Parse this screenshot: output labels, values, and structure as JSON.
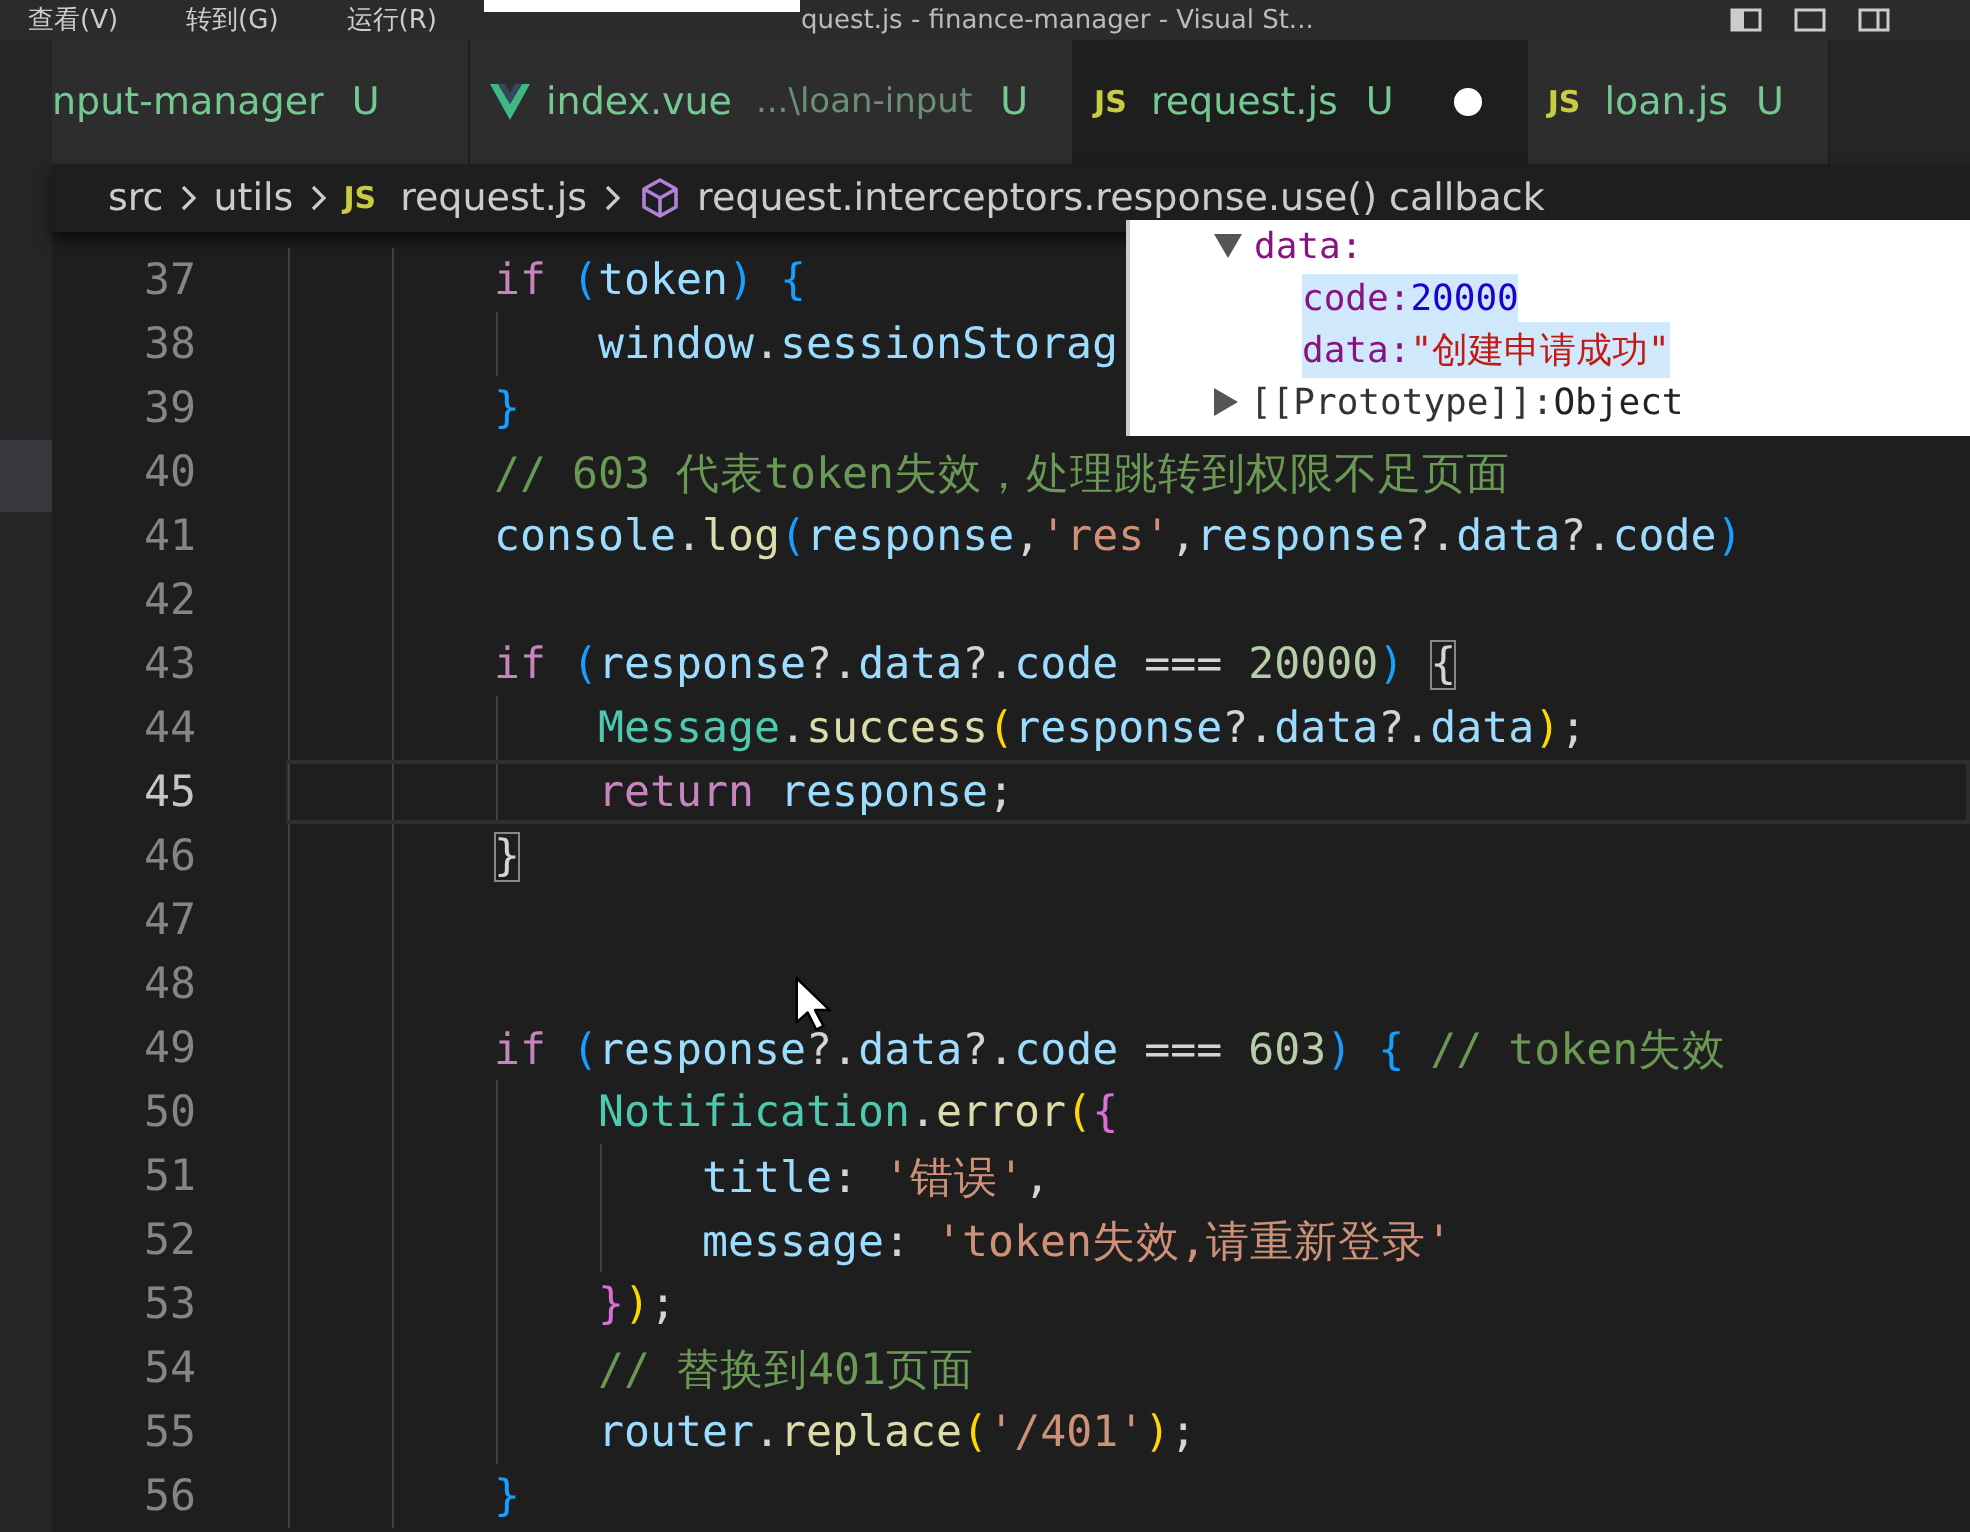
{
  "title_bar": {
    "menu": [
      "查看(V)",
      "转到(G)",
      "运行(R)"
    ],
    "title": "quest.js - finance-manager - Visual St..."
  },
  "tabs": [
    {
      "kind": "plain",
      "label": "nput-manager",
      "status": "U",
      "selected": false,
      "dirty": false
    },
    {
      "kind": "vue",
      "label": "index.vue",
      "description": "...\\loan-input",
      "status": "U",
      "selected": false,
      "dirty": false
    },
    {
      "kind": "script",
      "icon_label": "JS",
      "label": "request.js",
      "status": "U",
      "selected": true,
      "dirty": true
    },
    {
      "kind": "script",
      "icon_label": "JS",
      "label": "loan.js",
      "status": "U",
      "selected": false,
      "dirty": false
    }
  ],
  "breadcrumb": [
    {
      "kind": "folder",
      "text": "src"
    },
    {
      "kind": "folder",
      "text": "utils"
    },
    {
      "kind": "script",
      "icon_label": "JS",
      "text": "request.js"
    },
    {
      "kind": "symbol",
      "text": "request.interceptors.response.use() callback"
    }
  ],
  "lines": [
    {
      "number": "37",
      "current": false,
      "tokens": [
        {
          "kind": "kw",
          "text": "        if"
        },
        {
          "kind": "bracket3",
          "text": " ("
        },
        {
          "kind": "var",
          "text": "token"
        },
        {
          "kind": "bracket3",
          "text": ") {"
        }
      ]
    },
    {
      "number": "38",
      "current": false,
      "tokens": [
        {
          "kind": "var",
          "text": "            window"
        },
        {
          "kind": "plain",
          "text": "."
        },
        {
          "kind": "var",
          "text": "sessionStorag"
        }
      ]
    },
    {
      "number": "39",
      "current": false,
      "tokens": [
        {
          "kind": "bracket3",
          "text": "        }"
        }
      ]
    },
    {
      "number": "40",
      "current": false,
      "tokens": [
        {
          "kind": "cmt",
          "text": "        // 603 代表token失效，处理跳转到权限不足页面"
        }
      ]
    },
    {
      "number": "41",
      "current": false,
      "tokens": [
        {
          "kind": "var",
          "text": "        console"
        },
        {
          "kind": "plain",
          "text": "."
        },
        {
          "kind": "fn",
          "text": "log"
        },
        {
          "kind": "bracket3",
          "text": "("
        },
        {
          "kind": "var",
          "text": "response"
        },
        {
          "kind": "plain",
          "text": ","
        },
        {
          "kind": "str",
          "text": "'res'"
        },
        {
          "kind": "plain",
          "text": ","
        },
        {
          "kind": "var",
          "text": "response"
        },
        {
          "kind": "plain",
          "text": "?."
        },
        {
          "kind": "var",
          "text": "data"
        },
        {
          "kind": "plain",
          "text": "?."
        },
        {
          "kind": "var",
          "text": "code"
        },
        {
          "kind": "bracket3",
          "text": ")"
        }
      ]
    },
    {
      "number": "42",
      "current": false
    },
    {
      "number": "43",
      "current": false,
      "tokens": [
        {
          "kind": "kw",
          "text": "        if"
        },
        {
          "kind": "bracket3",
          "text": " ("
        },
        {
          "kind": "var",
          "text": "response"
        },
        {
          "kind": "plain",
          "text": "?."
        },
        {
          "kind": "var",
          "text": "data"
        },
        {
          "kind": "plain",
          "text": "?."
        },
        {
          "kind": "var",
          "text": "code"
        },
        {
          "kind": "plain",
          "text": " === "
        },
        {
          "kind": "num",
          "text": "20000"
        },
        {
          "kind": "bracket3",
          "text": ") "
        },
        {
          "kind": "match",
          "text": "{"
        }
      ]
    },
    {
      "number": "44",
      "current": false,
      "tokens": [
        {
          "kind": "type",
          "text": "            Message"
        },
        {
          "kind": "plain",
          "text": "."
        },
        {
          "kind": "fn",
          "text": "success"
        },
        {
          "kind": "bracket1",
          "text": "("
        },
        {
          "kind": "var",
          "text": "response"
        },
        {
          "kind": "plain",
          "text": "?."
        },
        {
          "kind": "var",
          "text": "data"
        },
        {
          "kind": "plain",
          "text": "?."
        },
        {
          "kind": "var",
          "text": "data"
        },
        {
          "kind": "bracket1",
          "text": ")"
        },
        {
          "kind": "plain",
          "text": ";"
        }
      ]
    },
    {
      "number": "45",
      "current": true,
      "tokens": [
        {
          "kind": "kw",
          "text": "            return"
        },
        {
          "kind": "var",
          "text": " response"
        },
        {
          "kind": "plain",
          "text": ";"
        }
      ]
    },
    {
      "number": "46",
      "current": false,
      "tokens": [
        {
          "kind": "match",
          "text": "        }"
        }
      ]
    },
    {
      "number": "47",
      "current": false
    },
    {
      "number": "48",
      "current": false
    },
    {
      "number": "49",
      "current": false,
      "tokens": [
        {
          "kind": "kw",
          "text": "        if"
        },
        {
          "kind": "bracket3",
          "text": " ("
        },
        {
          "kind": "var",
          "text": "response"
        },
        {
          "kind": "plain",
          "text": "?."
        },
        {
          "kind": "var",
          "text": "data"
        },
        {
          "kind": "plain",
          "text": "?."
        },
        {
          "kind": "var",
          "text": "code"
        },
        {
          "kind": "plain",
          "text": " === "
        },
        {
          "kind": "num",
          "text": "603"
        },
        {
          "kind": "bracket3",
          "text": ") {"
        },
        {
          "kind": "cmt",
          "text": " // token失效"
        }
      ]
    },
    {
      "number": "50",
      "current": false,
      "tokens": [
        {
          "kind": "type",
          "text": "            Notification"
        },
        {
          "kind": "plain",
          "text": "."
        },
        {
          "kind": "fn",
          "text": "error"
        },
        {
          "kind": "bracket1",
          "text": "("
        },
        {
          "kind": "bracket2",
          "text": "{"
        }
      ]
    },
    {
      "number": "51",
      "current": false,
      "tokens": [
        {
          "kind": "var",
          "text": "                title"
        },
        {
          "kind": "plain",
          "text": ": "
        },
        {
          "kind": "str",
          "text": "'错误'"
        },
        {
          "kind": "plain",
          "text": ","
        }
      ]
    },
    {
      "number": "52",
      "current": false,
      "tokens": [
        {
          "kind": "var",
          "text": "                message"
        },
        {
          "kind": "plain",
          "text": ": "
        },
        {
          "kind": "str",
          "text": "'token失效,请重新登录'"
        }
      ]
    },
    {
      "number": "53",
      "current": false,
      "tokens": [
        {
          "kind": "bracket2",
          "text": "            }"
        },
        {
          "kind": "bracket1",
          "text": ")"
        },
        {
          "kind": "plain",
          "text": ";"
        }
      ]
    },
    {
      "number": "54",
      "current": false,
      "tokens": [
        {
          "kind": "cmt",
          "text": "            // 替换到401页面"
        }
      ]
    },
    {
      "number": "55",
      "current": false,
      "tokens": [
        {
          "kind": "var",
          "text": "            router"
        },
        {
          "kind": "plain",
          "text": "."
        },
        {
          "kind": "fn",
          "text": "replace"
        },
        {
          "kind": "bracket1",
          "text": "("
        },
        {
          "kind": "str",
          "text": "'/401'"
        },
        {
          "kind": "bracket1",
          "text": ")"
        },
        {
          "kind": "plain",
          "text": ";"
        }
      ]
    },
    {
      "number": "56",
      "current": false,
      "tokens": [
        {
          "kind": "bracket3",
          "text": "        }"
        }
      ]
    }
  ],
  "devtools_popup": {
    "rows": [
      {
        "kind": "expanded",
        "key": "data:",
        "highlighted": false
      },
      {
        "kind": "number",
        "key": "code:",
        "value": "20000",
        "highlighted": true
      },
      {
        "kind": "string",
        "key": "data:",
        "value": "\"创建申请成功\"",
        "highlighted": true
      },
      {
        "kind": "collapsed",
        "key": "[[Prototype]]:",
        "value": "Object",
        "highlighted": false
      }
    ]
  }
}
